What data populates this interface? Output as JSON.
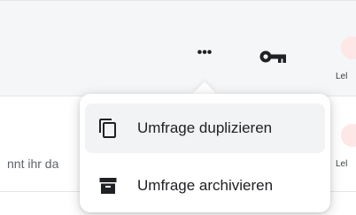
{
  "toolbar": {
    "more_label": "•••",
    "right_label_1": "Lel",
    "right_label_2": "Lel"
  },
  "list": {
    "snippet_text": "nnt ihr da"
  },
  "menu": {
    "items": [
      {
        "label": "Umfrage duplizieren",
        "icon": "duplicate-icon"
      },
      {
        "label": "Umfrage archivieren",
        "icon": "archive-icon"
      }
    ]
  },
  "colors": {
    "toolbar_bg": "#f5f6f7",
    "menu_hover": "#f1f3f4",
    "text": "#202124"
  }
}
